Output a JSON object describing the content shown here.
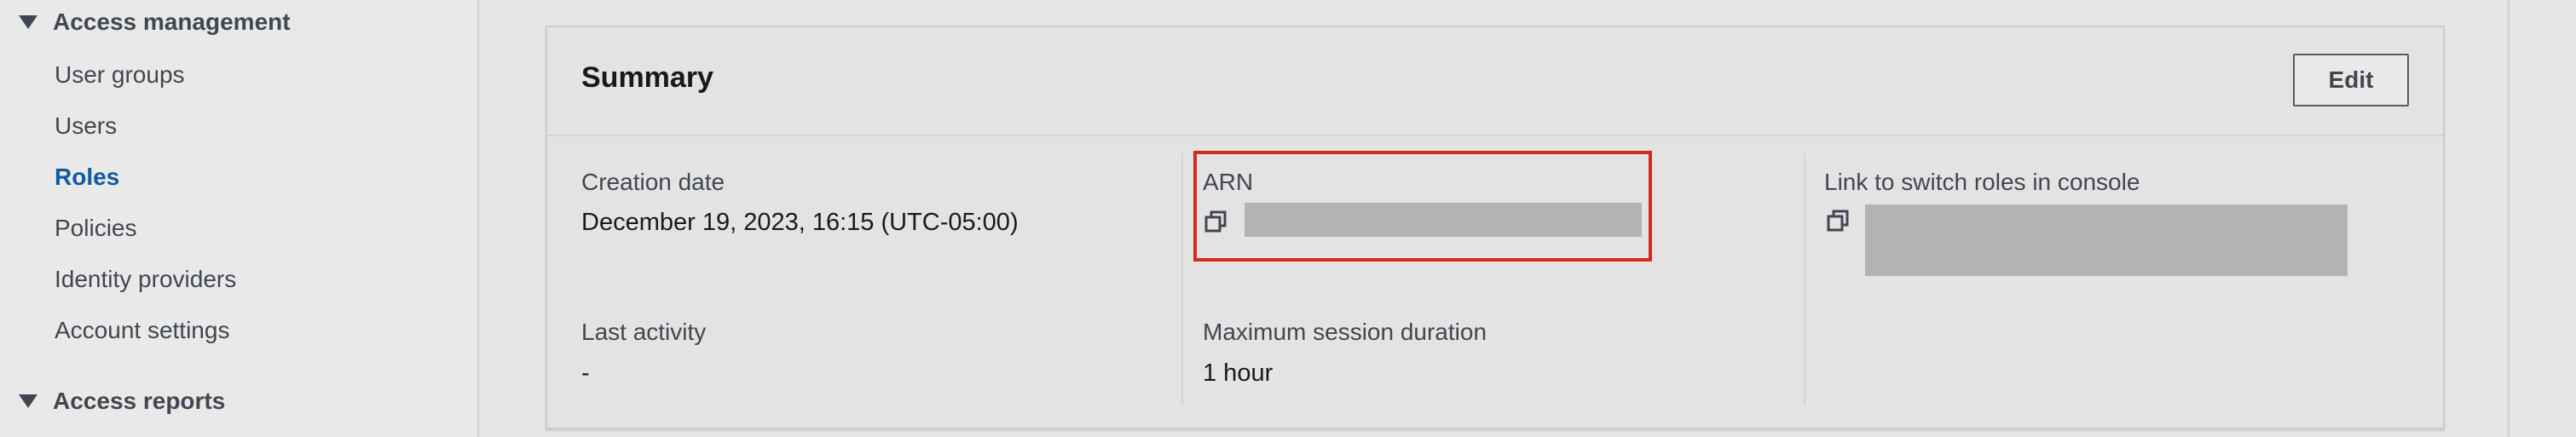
{
  "sidebar": {
    "sections": [
      {
        "label": "Access management"
      },
      {
        "label": "Access reports"
      }
    ],
    "items": [
      {
        "label": "User groups",
        "active": false
      },
      {
        "label": "Users",
        "active": false
      },
      {
        "label": "Roles",
        "active": true
      },
      {
        "label": "Policies",
        "active": false
      },
      {
        "label": "Identity providers",
        "active": false
      },
      {
        "label": "Account settings",
        "active": false
      }
    ]
  },
  "summary": {
    "title": "Summary",
    "edit_label": "Edit",
    "creation_date": {
      "label": "Creation date",
      "value": "December 19, 2023, 16:15 (UTC-05:00)"
    },
    "last_activity": {
      "label": "Last activity",
      "value": "-"
    },
    "arn": {
      "label": "ARN",
      "value_redacted": true
    },
    "max_session": {
      "label": "Maximum session duration",
      "value": "1 hour"
    },
    "switch_roles_link": {
      "label": "Link to switch roles in console",
      "value_redacted": true
    }
  },
  "colors": {
    "active_nav": "#0f5aa0",
    "highlight": "#d42a1f",
    "redaction": "#b3b3b3"
  },
  "icons": {
    "section_toggle": "caret-down-icon",
    "copy": "copy-icon"
  }
}
